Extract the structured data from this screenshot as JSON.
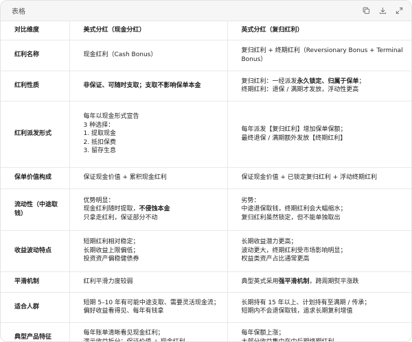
{
  "card": {
    "title": "表格"
  },
  "toolbar": {
    "icons": [
      "copy-icon",
      "download-icon",
      "expand-icon"
    ]
  },
  "table": {
    "headers": [
      "对比维度",
      "美式分红（现金分红）",
      "英式分红（复归红利）"
    ],
    "rows": [
      {
        "dimension": "红利名称",
        "us": [
          [
            "现金红利（Cash Bonus）"
          ]
        ],
        "uk": [
          [
            "复归红利 + 终期红利（Reversionary Bonus + Terminal Bonus）"
          ]
        ]
      },
      {
        "dimension": "红利性质",
        "us": [
          [
            "非保证、可随时支取；支取不影响保单本金"
          ]
        ],
        "uk": [
          [
            "复归红利：一经派发",
            "永久锁定、归属于保单",
            "；"
          ],
          [
            "终期红利：退保 / 满期才发放，浮动性更高"
          ]
        ]
      },
      {
        "dimension": "红利派发形式",
        "us": [
          [
            "每年以现金形式宣告"
          ],
          [
            "3 种选择："
          ],
          [
            "1. 提取现金"
          ],
          [
            "2. 抵扣保费"
          ],
          [
            "3. 留存生息"
          ]
        ],
        "uk": [
          [
            "每年派发【复归红利】增加保单保额；"
          ],
          [
            "最终退保 / 满期额外发放【终期红利】"
          ]
        ]
      },
      {
        "dimension": "保单价值构成",
        "us": [
          [
            "保证现金价值 + 累积现金红利"
          ]
        ],
        "uk": [
          [
            "保证现金价值 + 已锁定复归红利 + 浮动终期红利"
          ]
        ]
      },
      {
        "dimension": "流动性（中途取钱）",
        "us": [
          [
            "优势明显："
          ],
          [
            "现金红利随时提取，",
            "不侵蚀本金"
          ],
          [
            "只拿走红利，保证部分不动"
          ]
        ],
        "uk": [
          [
            "劣势："
          ],
          [
            "中途退保取钱，终期红利会大幅缩水；"
          ],
          [
            "复归红利虽然锁定，但不能单独取出"
          ]
        ]
      },
      {
        "dimension": "收益波动特点",
        "us": [
          [
            "短期红利相对稳定；"
          ],
          [
            "长期收益上限偏低；"
          ],
          [
            "投资资产偏稳健债券"
          ]
        ],
        "uk": [
          [
            "长期收益潜力更高；"
          ],
          [
            "波动更大，终期红利受市场影响明显；"
          ],
          [
            "权益类资产占比通常更高"
          ]
        ]
      },
      {
        "dimension": "平滑机制",
        "us": [
          [
            "红利平滑力度较弱"
          ]
        ],
        "uk": [
          [
            "典型英式采用",
            "强平滑机制",
            "，跨周期熨平涨跌"
          ]
        ]
      },
      {
        "dimension": "适合人群",
        "us": [
          [
            "短期 5–10 年有可能中途支取、需要灵活现金流；"
          ],
          [
            "偏好收益看得见、每年有钱拿"
          ]
        ],
        "uk": [
          [
            "长期持有 15 年以上、计划持有至满期 / 传承；"
          ],
          [
            "短期内不会退保取钱，追求长期复利增值"
          ]
        ]
      },
      {
        "dimension": "典型产品特征",
        "us": [
          [
            "每年账单清晰看见现金红利；"
          ],
          [
            "演示收益拆分：保证价值 + 现金红利"
          ]
        ],
        "uk": [
          [
            "每年保额上涨；"
          ],
          [
            "大部分收益集中在中后期终期红利"
          ]
        ]
      }
    ]
  }
}
